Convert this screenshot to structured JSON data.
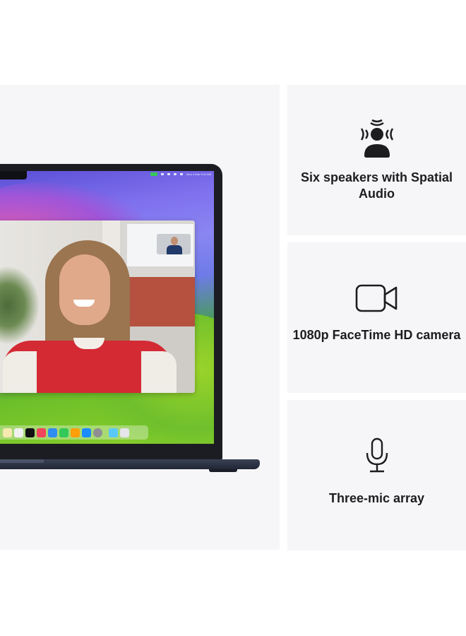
{
  "laptop": {
    "menubar_clock": "Mon 4 Mar 9:41 AM",
    "dock_apps": [
      "notes",
      "freeform",
      "apple-tv",
      "music",
      "keynote",
      "numbers",
      "pages",
      "app-store",
      "system-settings",
      "downloads",
      "trash"
    ]
  },
  "features": [
    {
      "icon": "spatial-audio-icon",
      "label": "Six speakers with Spatial Audio"
    },
    {
      "icon": "video-camera-icon",
      "label": "1080p FaceTime HD camera"
    },
    {
      "icon": "microphone-icon",
      "label": "Three-mic array"
    }
  ],
  "colors": {
    "panel": "#f6f6f8",
    "text": "#1d1d1f",
    "laptop": "#1c1d22"
  }
}
